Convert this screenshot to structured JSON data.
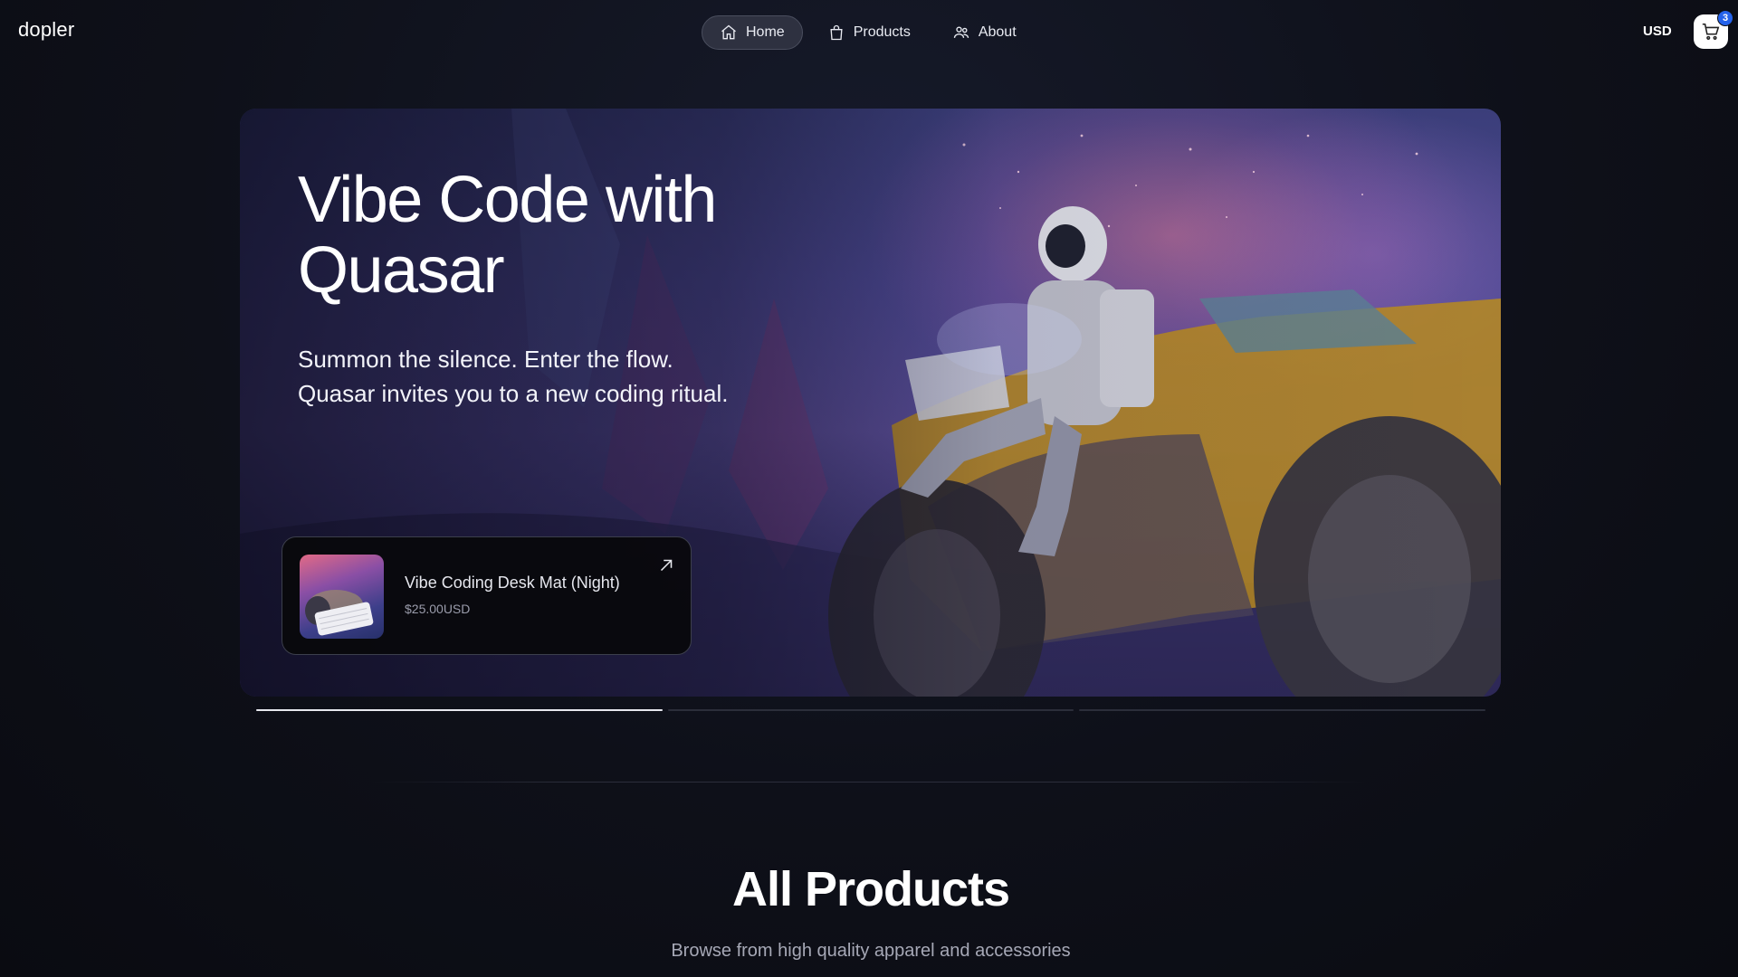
{
  "brand": {
    "logo": "dopler"
  },
  "nav": {
    "items": [
      {
        "label": "Home",
        "icon": "home-icon",
        "active": true
      },
      {
        "label": "Products",
        "icon": "shopping-bag-icon",
        "active": false
      },
      {
        "label": "About",
        "icon": "users-icon",
        "active": false
      }
    ]
  },
  "header": {
    "currency": "USD",
    "cart_count": "3"
  },
  "hero": {
    "title": "Vibe Code with Quasar",
    "subtitle_line1": "Summon the silence. Enter the flow.",
    "subtitle_line2": "Quasar invites you to a new coding ritual.",
    "featured_product": {
      "name": "Vibe Coding Desk Mat (Night)",
      "price": "$25.00USD"
    },
    "slides": {
      "count": 3,
      "active_index": 0,
      "active_progress": 1.0
    }
  },
  "products_section": {
    "title": "All Products",
    "subtitle": "Browse from high quality apparel and accessories"
  },
  "colors": {
    "background": "#0d0f16",
    "accent_badge": "#2563eb",
    "nav_active_bg": "#2e3140"
  }
}
